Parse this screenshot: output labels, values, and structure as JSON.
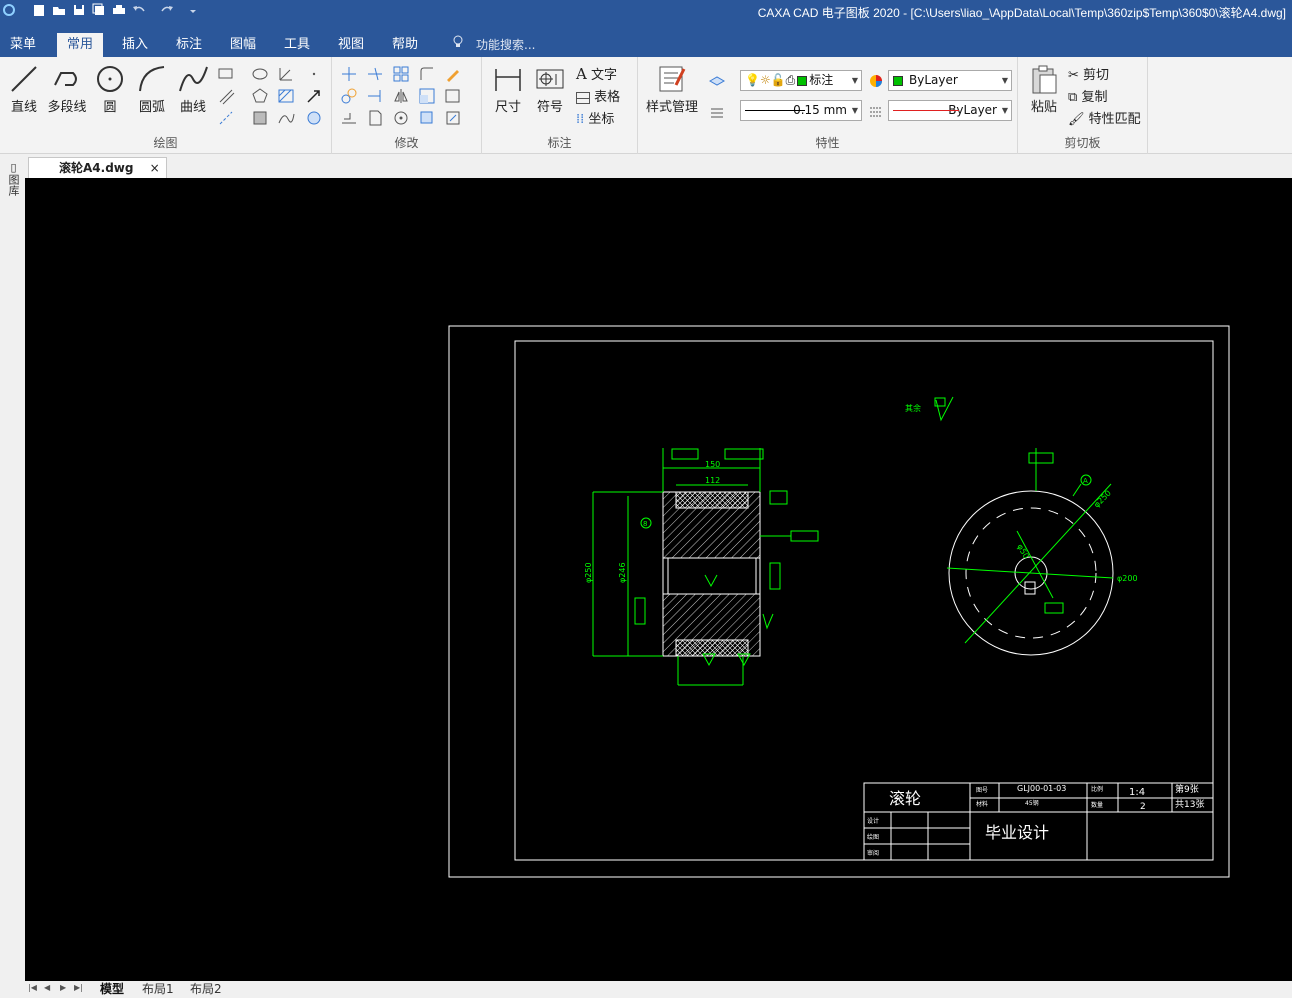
{
  "window": {
    "title": "CAXA CAD 电子图板 2020 - [C:\\Users\\liao_\\AppData\\Local\\Temp\\360zip$Temp\\360$0\\滚轮A4.dwg]"
  },
  "menubar": {
    "tabs": [
      {
        "label": "菜单",
        "active": false
      },
      {
        "label": "常用",
        "active": true
      },
      {
        "label": "插入",
        "active": false
      },
      {
        "label": "标注",
        "active": false
      },
      {
        "label": "图幅",
        "active": false
      },
      {
        "label": "工具",
        "active": false
      },
      {
        "label": "视图",
        "active": false
      },
      {
        "label": "帮助",
        "active": false
      }
    ],
    "search_label": "功能搜索..."
  },
  "ribbon": {
    "draw": {
      "label": "绘图",
      "line": "直线",
      "polyline": "多段线",
      "circle": "圆",
      "arc": "圆弧",
      "curve": "曲线"
    },
    "modify": {
      "label": "修改"
    },
    "annotate": {
      "label": "标注",
      "dimension": "尺寸",
      "symbol": "符号",
      "text": "文字",
      "table": "表格",
      "coordinate": "坐标"
    },
    "properties": {
      "label": "特性",
      "style_manager": "样式管理",
      "layer_value": "标注",
      "color_value": "ByLayer",
      "lineweight_value": "0.15 mm",
      "linetype_value": "ByLayer"
    },
    "clipboard": {
      "label": "剪切板",
      "paste": "粘贴",
      "cut": "剪切",
      "copy": "复制",
      "match_properties": "特性匹配"
    }
  },
  "doc_tab": {
    "file_name": "滚轮A4.dwg",
    "close_glyph": "×"
  },
  "side_panel": {
    "label": "图库"
  },
  "drawing": {
    "surface_note": "其余",
    "dims": {
      "d150": "150",
      "d112": "112",
      "phi250": "φ250",
      "phi246": "φ246",
      "r250": "φ250",
      "phi200": "φ200",
      "phi50": "φ50",
      "balloon": "8",
      "balloon2": "A"
    },
    "title_block": {
      "part_name": "滚轮",
      "drawing_no_label": "图号",
      "drawing_no": "GLJ00-01-03",
      "scale_label": "比例",
      "scale": "1:4",
      "sheet": "第9张",
      "material_label": "材料",
      "material": "45钢",
      "qty_label": "数量",
      "qty": "2",
      "total": "共13张",
      "design_label": "设计",
      "draw_label": "绘图",
      "review_label": "审阅",
      "project": "毕业设计"
    }
  },
  "status": {
    "layout_tabs": [
      {
        "label": "模型",
        "active": true
      },
      {
        "label": "布局1",
        "active": false
      },
      {
        "label": "布局2",
        "active": false
      }
    ]
  }
}
